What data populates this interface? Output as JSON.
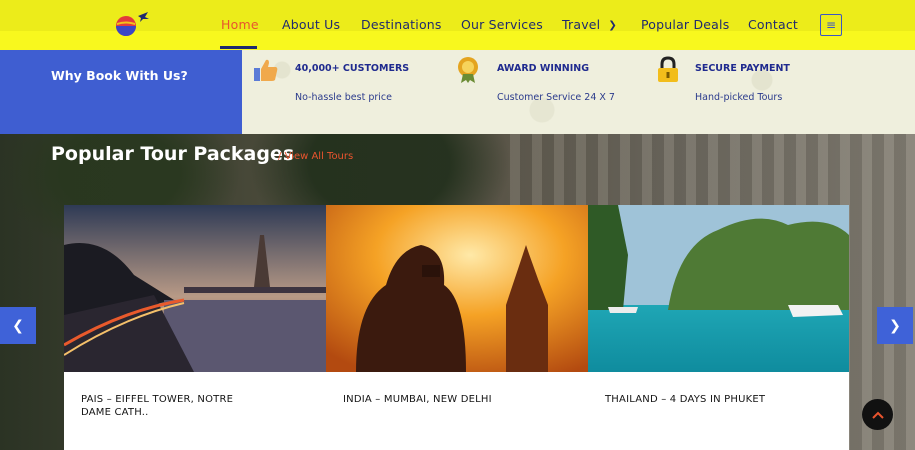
{
  "header": {
    "logo_name": "globe-plane-logo",
    "nav": [
      {
        "label": "Home",
        "active": true
      },
      {
        "label": "About Us"
      },
      {
        "label": "Destinations"
      },
      {
        "label": "Our Services"
      },
      {
        "label": "Travel"
      },
      {
        "label": "Popular Deals"
      },
      {
        "label": "Contact"
      }
    ],
    "menu_icon": "hamburger-icon"
  },
  "why": {
    "title": "Why Book With Us?",
    "features": [
      {
        "icon": "thumbs-up-icon",
        "title": "40,000+ CUSTOMERS",
        "subtitle": "No-hassle best price"
      },
      {
        "icon": "award-badge-icon",
        "title": "AWARD WINNING",
        "subtitle": "Customer Service 24 X 7"
      },
      {
        "icon": "padlock-icon",
        "title": "SECURE PAYMENT",
        "subtitle": "Hand-picked Tours"
      }
    ]
  },
  "packages": {
    "title": "Popular Tour Packages",
    "link": "/ View All Tours",
    "cards": [
      {
        "title_line1": "PAIS – EIFFEL TOWER, NOTRE",
        "title_line2": "DAME CATH.."
      },
      {
        "title_line1": "INDIA – MUMBAI, NEW DELHI",
        "title_line2": ""
      },
      {
        "title_line1": "THAILAND – 4 DAYS IN PHUKET",
        "title_line2": ""
      }
    ],
    "prev_icon": "chevron-left-icon",
    "next_icon": "chevron-right-icon"
  },
  "colors": {
    "accent": "#e8542e",
    "nav_text": "#1f2a6e",
    "header_bg": "#ecec1a",
    "why_bg": "#3f5ed1"
  }
}
